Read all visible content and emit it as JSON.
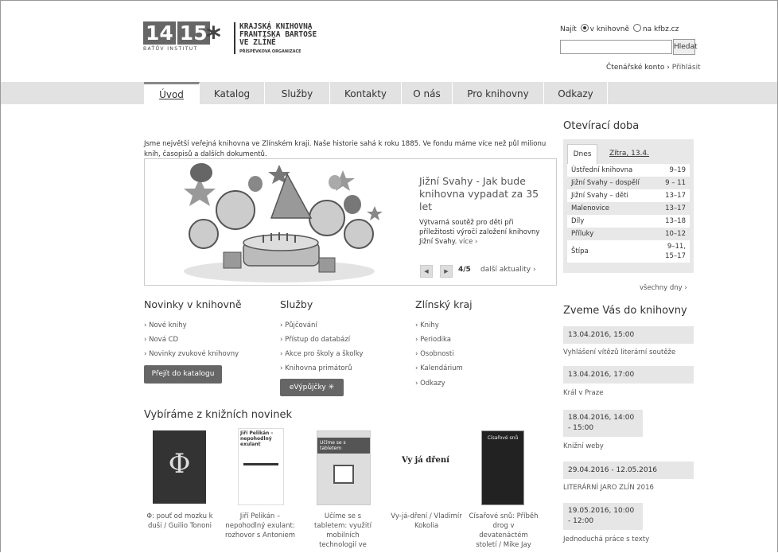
{
  "header": {
    "logo_box1": "14",
    "logo_box2": "15",
    "logo_sub": "BAŤŮV INSTITUT",
    "library_name_1": "KRAJSKÁ KNIHOVNA",
    "library_name_2": "FRANTIŠKA BARTOŠE",
    "library_name_3": "VE ZLÍNĚ",
    "library_sub": "PŘÍSPĚVKOVÁ ORGANIZACE",
    "search_label": "Najít",
    "search_opt1": "v knihovně",
    "search_opt2": "na kfbz.cz",
    "search_value": "",
    "search_button": "Hledat",
    "account_label": "Čtenářské konto ›",
    "login_link": "Přihlásit"
  },
  "nav": [
    "Úvod",
    "Katalog",
    "Služby",
    "Kontakty",
    "O nás",
    "Pro knihovny",
    "Odkazy"
  ],
  "intro": "Jsme největší veřejná knihovna ve Zlínském kraji. Naše historie sahá k roku 1885. Ve fondu máme více než půl milionu knih, časopisů a dalších dokumentů.",
  "carousel": {
    "title": "Jižní Svahy - Jak bude knihovna vypadat za 35 let",
    "text": "Výtvarná soutěž pro děti při příležitosti výročí založení knihovny Jižní Svahy.",
    "more": "více ›",
    "counter": "4/5",
    "news_link": "další aktuality ›",
    "prev": "◀",
    "next": "▶"
  },
  "news": {
    "title": "Novinky v knihovně",
    "links": [
      "› Nové knihy",
      "› Nová CD",
      "› Novinky zvukové knihovny"
    ],
    "button": "Přejít do katalogu"
  },
  "services": {
    "title": "Služby",
    "links": [
      "› Půjčování",
      "› Přístup do databází",
      "› Akce pro školy a školky",
      "› Knihovna primátorů"
    ],
    "button": "eVýpůjčky ✳"
  },
  "region": {
    "title": "Zlínský kraj",
    "links": [
      "› Knihy",
      "› Periodika",
      "› Osobnosti",
      "› Kalendárium",
      "› Odkazy"
    ]
  },
  "books": {
    "title": "Vybíráme z knižních novinek",
    "items": [
      {
        "caption": "Φ: pouť od mozku k duši / Guilio Tononi",
        "cover_text": "Φ"
      },
      {
        "caption": "Jiří Pelikán – nepohodlný exulant: rozhovor s Antoniem",
        "cover_text": "Jiří Pelikán – nepohodlný exulant"
      },
      {
        "caption": "Učíme se s tabletem: využití mobilních technologií ve",
        "cover_text": "Učíme se s tabletem"
      },
      {
        "caption": "Vy-já-dření / Vladimír Kokolia",
        "cover_text": "Vy já dření"
      },
      {
        "caption": "Císařové snů: Příběh drog v devatenáctém století / Mike Jay",
        "cover_text": "Císařové snů"
      }
    ]
  },
  "hours": {
    "title": "Otevírací doba",
    "tab_today": "Dnes",
    "tab_tomorrow": "Zítra, 13.4.",
    "rows": [
      {
        "place": "Ústřední knihovna",
        "time": "9–19"
      },
      {
        "place": "Jižní Svahy – dospělí",
        "time": "9 – 11"
      },
      {
        "place": "Jižní Svahy – děti",
        "time": "13–17"
      },
      {
        "place": "Malenovice",
        "time": "13–17"
      },
      {
        "place": "Díly",
        "time": "13–18"
      },
      {
        "place": "Příluky",
        "time": "10–12"
      },
      {
        "place": "Štípa",
        "time": "9–11, 15–17"
      }
    ],
    "all_days": "všechny dny ›"
  },
  "events": {
    "title": "Zveme Vás do knihovny",
    "items": [
      {
        "date": "13.04.2016, 15:00",
        "title": "Vyhlášení vítězů literární soutěže"
      },
      {
        "date": "13.04.2016, 17:00",
        "title": "Král v Praze"
      },
      {
        "date": "18.04.2016, 14:00 - 15:00",
        "title": "Knižní weby"
      },
      {
        "date": "29.04.2016 - 12.05.2016",
        "title": "LITERÁRNÍ JARO ZLÍN 2016"
      },
      {
        "date": "19.05.2016, 10:00 - 12:00",
        "title": "Jednoduchá práce s texty"
      }
    ]
  }
}
